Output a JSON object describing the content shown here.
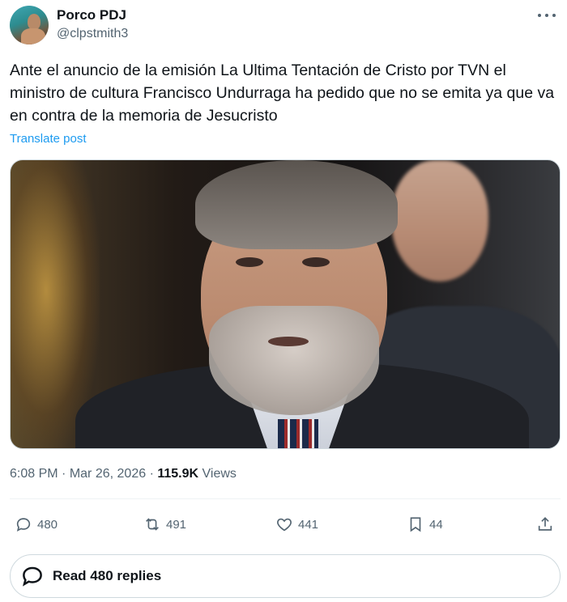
{
  "author": {
    "display_name": "Porco PDJ",
    "handle": "@clpstmith3"
  },
  "tweet": {
    "text": "Ante el anuncio de la emisión La Ultima Tentación de Cristo por TVN el ministro de cultura Francisco Undurraga ha pedido que no se emita ya que va en contra de la memoria de Jesucristo",
    "translate_label": "Translate post",
    "time": "6:08 PM",
    "separator": "·",
    "date": "Mar 26, 2026",
    "views_count": "115.9K",
    "views_label": "Views"
  },
  "actions": {
    "replies": "480",
    "reposts": "491",
    "likes": "441",
    "bookmarks": "44"
  },
  "read_replies": {
    "label": "Read 480 replies"
  },
  "icons": [
    "more-icon",
    "reply-icon",
    "repost-icon",
    "like-icon",
    "bookmark-icon",
    "share-icon",
    "conversation-icon"
  ],
  "colors": {
    "link": "#1d9bf0",
    "text": "#0f1419",
    "secondary": "#536471",
    "border": "#cfd9de"
  }
}
